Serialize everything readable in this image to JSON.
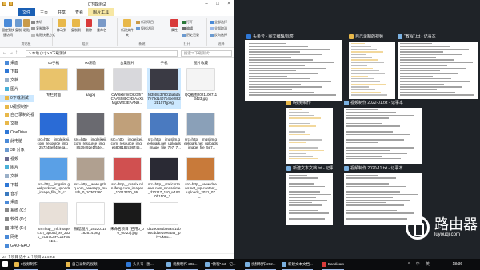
{
  "explorer": {
    "title": "0下载测试",
    "tabs": [
      "文件",
      "主页",
      "共享",
      "查看",
      "图片工具"
    ],
    "manage_tab": "管理",
    "ribbon": {
      "pin_label": "固定到快速访问",
      "copy_label": "复制",
      "paste_label": "粘贴",
      "cut_label": "剪切",
      "copy_path_label": "复制路径",
      "paste_shortcut_label": "粘贴快捷方式",
      "move_to_label": "移动到",
      "copy_to_label": "复制到",
      "delete_label": "删除",
      "rename_label": "重命名",
      "new_folder_label": "新建文件夹",
      "new_item_label": "新建项目",
      "easy_access_label": "轻松访问",
      "properties_label": "属性",
      "open_label": "打开",
      "edit_label": "编辑",
      "history_label": "历史记录",
      "select_all_label": "全部选择",
      "select_none_label": "全部取消",
      "invert_label": "反向选择",
      "group_clipboard": "剪贴板",
      "group_organize": "组织",
      "group_new": "新建",
      "group_open": "打开",
      "group_select": "选择"
    },
    "address": "> 本地 (E:) > 0下载测试",
    "search_placeholder": "搜索\"0下载测试\"",
    "nav": [
      {
        "label": "桌面",
        "icon": "desktop-icon"
      },
      {
        "label": "下载",
        "icon": "download-icon"
      },
      {
        "label": "文档",
        "icon": "document-icon"
      },
      {
        "label": "图片",
        "icon": "picture-icon"
      },
      {
        "label": "0下载测试",
        "icon": "folder-icon"
      },
      {
        "label": "0视频制作",
        "icon": "folder-icon"
      },
      {
        "label": "自己录制的视频",
        "icon": "folder-icon"
      },
      {
        "label": "文档",
        "icon": "folder-icon"
      },
      {
        "label": "OneDrive",
        "icon": "onedrive-icon"
      },
      {
        "label": "此电脑",
        "icon": "pc-icon"
      },
      {
        "label": "3D 对象",
        "icon": "3d-icon"
      },
      {
        "label": "视频",
        "icon": "video-icon"
      },
      {
        "label": "图片",
        "icon": "picture-icon"
      },
      {
        "label": "文档",
        "icon": "document-icon"
      },
      {
        "label": "下载",
        "icon": "download-icon"
      },
      {
        "label": "音乐",
        "icon": "music-icon"
      },
      {
        "label": "桌面",
        "icon": "desktop-icon"
      },
      {
        "label": "系统 (C:)",
        "icon": "drive-icon"
      },
      {
        "label": "软件 (D:)",
        "icon": "drive-icon"
      },
      {
        "label": "本地 (E:)",
        "icon": "drive-icon"
      },
      {
        "label": "网络",
        "icon": "network-icon"
      },
      {
        "label": "GAO-GAO",
        "icon": "computer-icon"
      }
    ],
    "top_labels": [
      "00手机",
      "00测验",
      "合集图片",
      "手机",
      "图片收藏"
    ],
    "files": [
      {
        "name": "专栏封面",
        "thumb": "#e9c36b"
      },
      {
        "name": "aa.jpg",
        "thumb": "#9a7a5a"
      },
      {
        "name": "CWt6ktmlmOKGfh7CAASh8bCvDiAAXsMgKWE3EAANH...",
        "thumb": "#d8d8dc"
      },
      {
        "name": "fd3f48c378016a5da7e79d1407b4bef8822b107f.jpeg",
        "thumb": "#3a3a44"
      },
      {
        "name": "QQ截图20211007113423.jpg",
        "thumb": "#f4f4f4"
      },
      {
        "name": "src=http__imgleikeji.com_resource_img_257248eff48e4a...",
        "thumb": "#2a6bd6"
      },
      {
        "name": "src=http__imgleikeji.com_resource_img_8539492e1f54e...",
        "thumb": "#6a6a70"
      },
      {
        "name": "src=http__imgleikeji.com_resource_img_e5808182c98745...",
        "thumb": "#c0a07a"
      },
      {
        "name": "src=http__imgslim.geekpark.net_uploads_image_file_7e7_7...",
        "thumb": "#4a7ac0"
      },
      {
        "name": "src=http__imgslim.geekpark.net_uploads_image_file_5e7...",
        "thumb": "#8aa0b8"
      },
      {
        "name": "src=http__imgslim.geekpark.net_uploads_image_file_f1_c1...",
        "thumb": "#5aa0e6"
      },
      {
        "name": "src=http__www.gzlnq.com_newsapp_match_0_10362360...",
        "thumb": "#b0a090"
      },
      {
        "name": "src=http__matrix.cdn.ifeng.com_images_10213700_36...",
        "thumb": "#d05050"
      },
      {
        "name": "src=http__static.sznews.com_sinaanime_d10117_110_w1920h1509_2...",
        "thumb": "#2a2a34"
      },
      {
        "name": "src=http__www.dnews.net_wp-content_uploads_2021_07_...",
        "thumb": "#c87a3a"
      },
      {
        "name": "src=http__nfl.images.cn_upload_xs_2021_EC57C8FC14F604E5...",
        "thumb": "#e8e0d8"
      },
      {
        "name": "微信图片_20220115182614.png",
        "thumb": "#ffffff"
      },
      {
        "name": "未命名项目 (已用0_00_00.23).jpg",
        "thumb": "#1a1a1a"
      },
      {
        "name": "d5290684b95a4f1db95cdd4e19e66a6_tplv-ok9tc...",
        "thumb": "#ffffff"
      }
    ],
    "status": "24 个项目   选中 1 个项目 21.5 KB"
  },
  "task_view": {
    "windows": [
      {
        "title": "头条号 - 图文编辑/标签",
        "icon": "edge-icon",
        "icon_color": "#2f78d6"
      },
      {
        "title": "自己录制的视频",
        "icon": "folder-icon",
        "icon_color": "#e8b84a"
      },
      {
        "title": "\"教程\".txt - 记事本",
        "icon": "notepad-icon",
        "icon_color": "#7ab0e0"
      },
      {
        "title": "0视频制作",
        "icon": "folder-icon",
        "icon_color": "#e8b84a"
      },
      {
        "title": "视频制作 2022-01.txt - 记事本",
        "icon": "notepad-icon",
        "icon_color": "#7ab0e0"
      },
      {
        "title": "新建文本文档.txt - 记事本",
        "icon": "notepad-icon",
        "icon_color": "#7ab0e0"
      },
      {
        "title": "视频制作 2020-11.txt - 记事本",
        "icon": "notepad-icon",
        "icon_color": "#7ab0e0"
      }
    ]
  },
  "taskbar": {
    "items": [
      {
        "label": "0视频制作",
        "icon_color": "#e8b84a"
      },
      {
        "label": "自己录制的视频",
        "icon_color": "#e8b84a"
      },
      {
        "label": "头条号 - 图...",
        "icon_color": "#2f78d6"
      },
      {
        "label": "视频制作 202...",
        "icon_color": "#7ab0e0"
      },
      {
        "label": "\"教程\".txt - 记...",
        "icon_color": "#7ab0e0"
      },
      {
        "label": "视频制作 202...",
        "icon_color": "#7ab0e0"
      },
      {
        "label": "新建文本文档...",
        "icon_color": "#7ab0e0"
      },
      {
        "label": "Bandicam",
        "icon_color": "#d83a3a"
      }
    ],
    "time": "18:36",
    "tray": "^ 中 英"
  },
  "watermark": {
    "name": "路由器",
    "domain": "luyouqi.com"
  }
}
